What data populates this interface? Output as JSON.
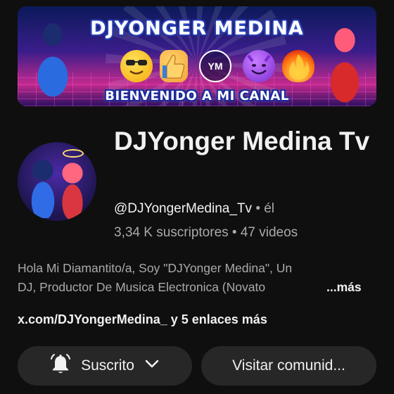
{
  "banner": {
    "title": "DJYONGER MEDINA",
    "subtitle": "BIENVENIDO A MI CANAL",
    "badge": "YM",
    "icons": [
      "sunglasses-emoji",
      "thumbs-up-emoji",
      "ym-logo",
      "smiling-devil-emoji",
      "fire-emoji"
    ]
  },
  "channel": {
    "name": "DJYonger Medina Tv",
    "handle": "@DJYongerMedina_Tv",
    "pronoun": "• él",
    "subscribers": "3,34 K suscriptores",
    "videos": "• 47 videos",
    "description_line1": "Hola Mi Diamantito/a, Soy \"DJYonger Medina\", Un",
    "description_line2": "DJ, Productor De Musica Electronica (Novato",
    "more_label": "...más",
    "links": "x.com/DJYongerMedina_ y 5 enlaces más"
  },
  "actions": {
    "subscribed_label": "Suscrito",
    "visit_label": "Visitar comunid..."
  },
  "colors": {
    "background": "#0f0f0f",
    "button_bg": "#272727",
    "text_primary": "#f1f1f1",
    "text_secondary": "#aaaaaa"
  }
}
